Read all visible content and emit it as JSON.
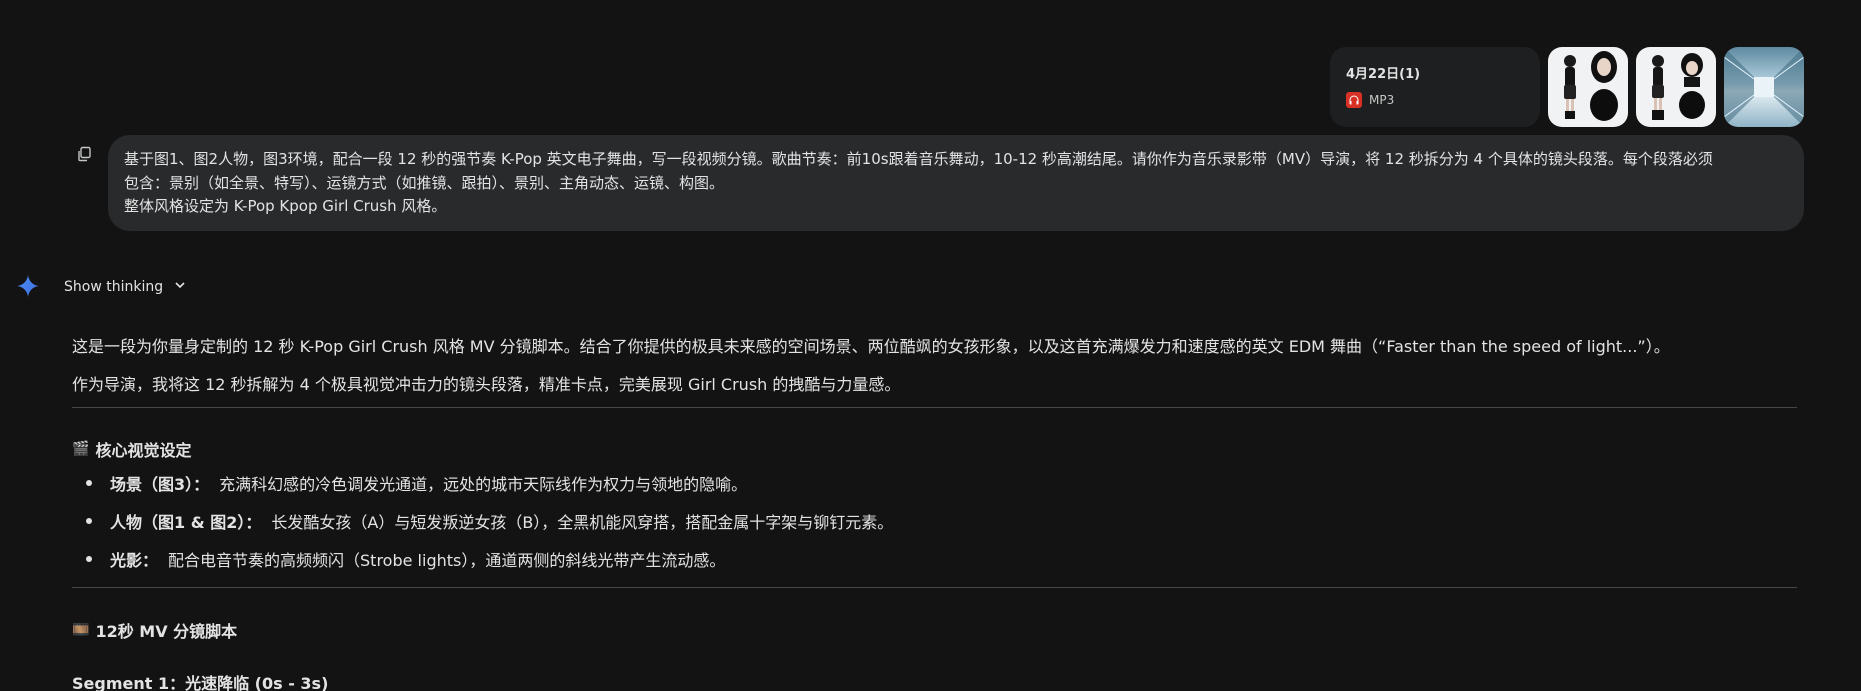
{
  "attachments": {
    "file": {
      "name": "4月22日(1)",
      "type": "MP3",
      "icon": "headphones-icon"
    },
    "images": [
      {
        "name": "image-1-thumbnail"
      },
      {
        "name": "image-2-thumbnail"
      },
      {
        "name": "image-3-thumbnail"
      }
    ]
  },
  "prompt": {
    "lines": [
      "基于图1、图2人物，图3环境，配合一段 12 秒的强节奏 K-Pop 英文电子舞曲，写一段视频分镜。歌曲节奏：前10s跟着音乐舞动，10-12 秒高潮结尾。请你作为音乐录影带（MV）导演，将 12 秒拆分为 4 个具体的镜头段落。每个段落必须",
      "包含：景别（如全景、特写）、运镜方式（如推镜、跟拍）、景别、主角动态、运镜、构图。",
      "整体风格设定为 K-Pop Kpop Girl Crush 风格。"
    ]
  },
  "thinking": {
    "label": "Show thinking"
  },
  "response": {
    "intro": "这是一段为你量身定制的 12 秒 K-Pop Girl Crush 风格 MV 分镜脚本。结合了你提供的极具未来感的空间场景、两位酷飒的女孩形象，以及这首充满爆发力和速度感的英文 EDM 舞曲（“Faster than the speed of light...”）。",
    "intro2": "作为导演，我将这 12 秒拆解为 4 个极具视觉冲击力的镜头段落，精准卡点，完美展现 Girl Crush 的拽酷与力量感。",
    "section1": {
      "emoji": "🎬",
      "title": "核心视觉设定",
      "items": [
        {
          "label": "场景（图3）：",
          "text": "充满科幻感的冷色调发光通道，远处的城市天际线作为权力与领地的隐喻。"
        },
        {
          "label": "人物（图1 & 图2）：",
          "text": "长发酷女孩（A）与短发叛逆女孩（B），全黑机能风穿搭，搭配金属十字架与铆钉元素。"
        },
        {
          "label": "光影：",
          "text": "配合电音节奏的高频频闪（Strobe lights），通道两侧的斜线光带产生流动感。"
        }
      ]
    },
    "section2": {
      "emoji": "🎞️",
      "title": "12秒 MV 分镜脚本"
    },
    "segment1": "Segment 1：光速降临 (0s - 3s)"
  },
  "colors": {
    "background": "#131314",
    "bubble": "#282a2c",
    "card": "#1e1f20",
    "spark": "#4285f4",
    "mp3": "#d93025"
  }
}
